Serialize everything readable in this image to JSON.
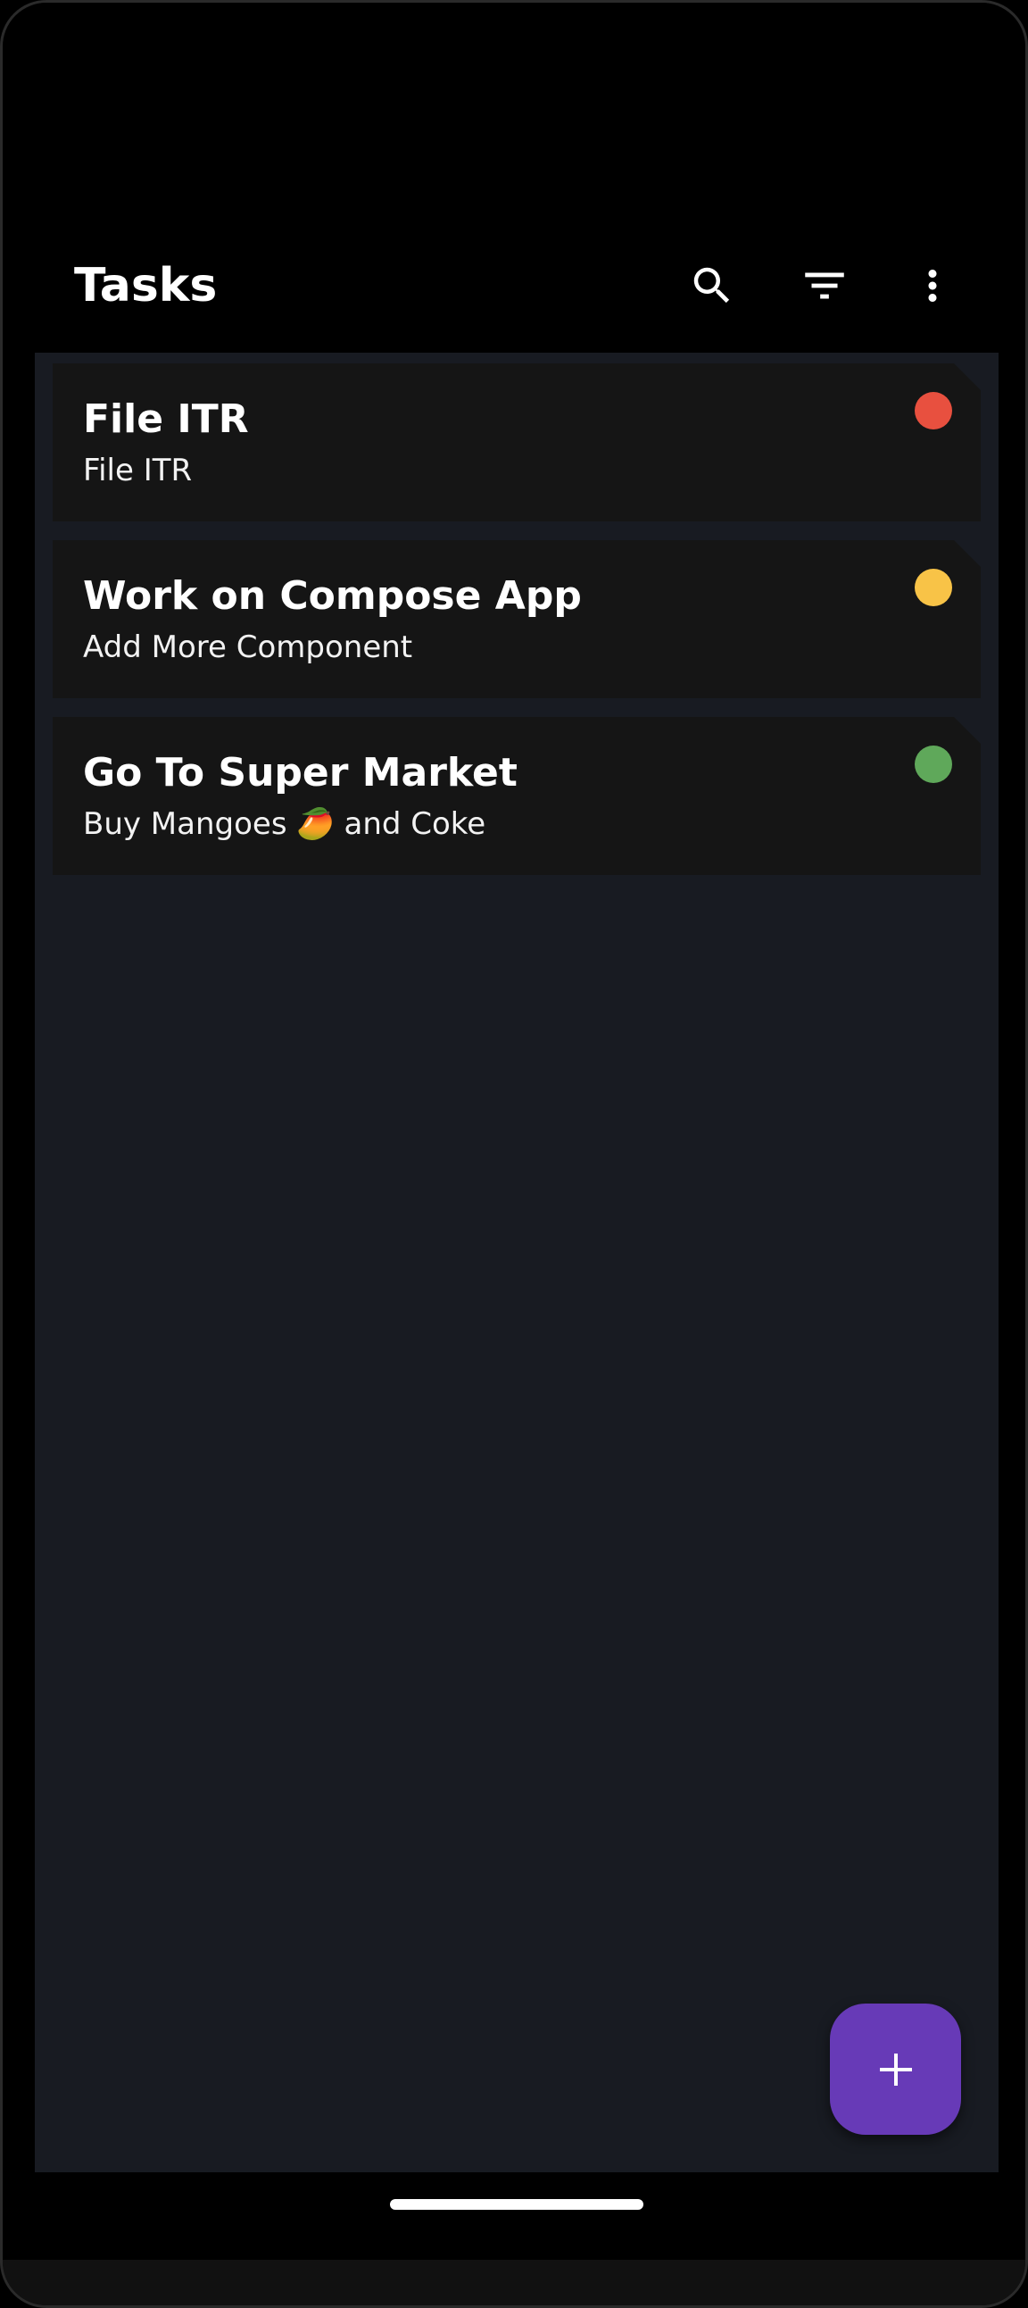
{
  "app_bar": {
    "title": "Tasks",
    "actions": [
      {
        "icon": "search-icon"
      },
      {
        "icon": "filter-list-icon"
      },
      {
        "icon": "more-vert-icon"
      }
    ]
  },
  "tasks": [
    {
      "title": "File ITR",
      "description": "File ITR",
      "priority_color": "#e8503f"
    },
    {
      "title": "Work on Compose App",
      "description": "Add More Component",
      "priority_color": "#f8c347"
    },
    {
      "title": "Go To Super Market",
      "description": "Buy Mangoes 🥭 and Coke",
      "priority_color": "#5fa85a"
    }
  ],
  "fab": {
    "icon": "plus-icon",
    "color": "#673ab7"
  },
  "colors": {
    "background": "#000000",
    "surface": "#181b22",
    "card": "#151515"
  }
}
